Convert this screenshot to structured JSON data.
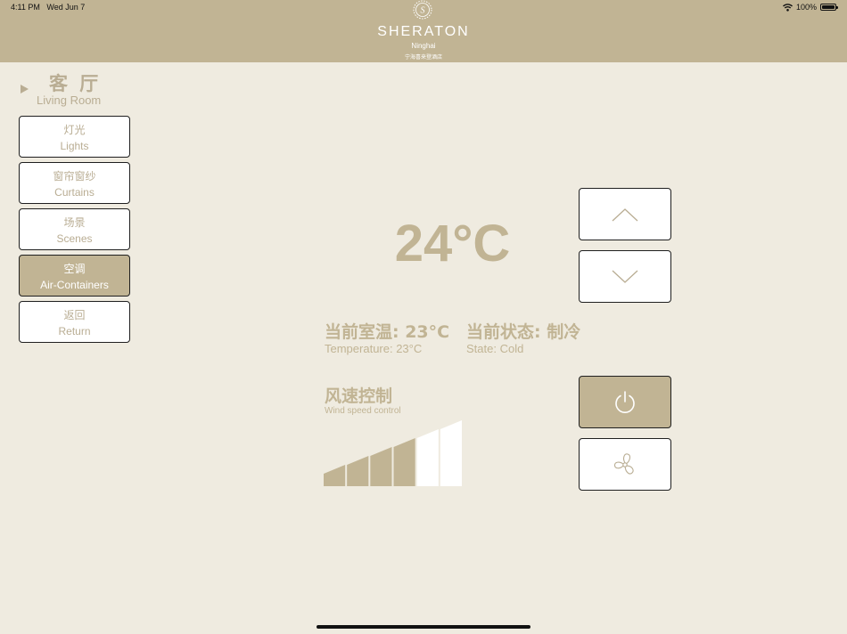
{
  "status_bar": {
    "time": "4:11 PM",
    "date": "Wed Jun 7",
    "battery": "100%"
  },
  "brand": {
    "name": "SHERATON",
    "city": "Ninghai",
    "name_cn": "宁海喜来登酒店"
  },
  "room": {
    "name_cn": "客 厅",
    "name_en": "Living Room"
  },
  "menu": [
    {
      "cn": "灯光",
      "en": "Lights",
      "active": false
    },
    {
      "cn": "窗帘窗纱",
      "en": "Curtains",
      "active": false
    },
    {
      "cn": "场景",
      "en": "Scenes",
      "active": false
    },
    {
      "cn": "空调",
      "en": "Air-Containers",
      "active": true
    },
    {
      "cn": "返回",
      "en": "Return",
      "active": false
    }
  ],
  "ac": {
    "set_temp": "24°C",
    "current_temp_cn": "当前室温: 23°C",
    "current_temp_en": "Temperature: 23°C",
    "state_cn": "当前状态: 制冷",
    "state_en": "State: Cold"
  },
  "wind": {
    "title_cn": "风速控制",
    "title_en": "Wind speed control",
    "level": 4,
    "levels": 6
  },
  "colors": {
    "accent": "#c1b494",
    "background": "#efebe0",
    "text": "#b9ad93"
  },
  "icons": {
    "up": "chevron-up-icon",
    "down": "chevron-down-icon",
    "power": "power-icon",
    "fan": "fan-icon"
  }
}
